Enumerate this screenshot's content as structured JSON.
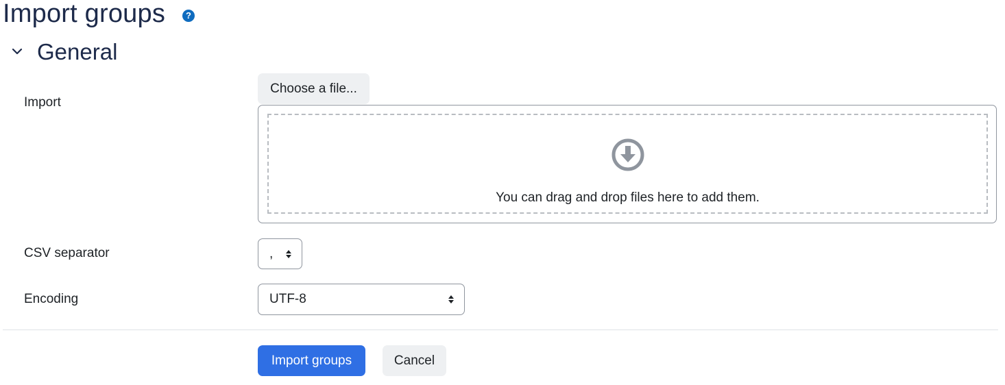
{
  "header": {
    "title": "Import groups",
    "help_icon": "question-circle-icon",
    "help_glyph": "?"
  },
  "section": {
    "title": "General",
    "toggle_icon": "chevron-down-icon",
    "expanded": true
  },
  "fields": {
    "import": {
      "label": "Import",
      "choose_button": "Choose a file...",
      "drop_icon": "arrow-circle-down-icon",
      "drop_text": "You can drag and drop files here to add them."
    },
    "csv_separator": {
      "label": "CSV separator",
      "selected": ","
    },
    "encoding": {
      "label": "Encoding",
      "selected": "UTF-8"
    }
  },
  "actions": {
    "submit_label": "Import groups",
    "cancel_label": "Cancel"
  },
  "colors": {
    "primary": "#2f6fe4",
    "heading": "#1d2a4a",
    "help_icon": "#0f6cbf",
    "icon_gray": "#8f959e"
  }
}
